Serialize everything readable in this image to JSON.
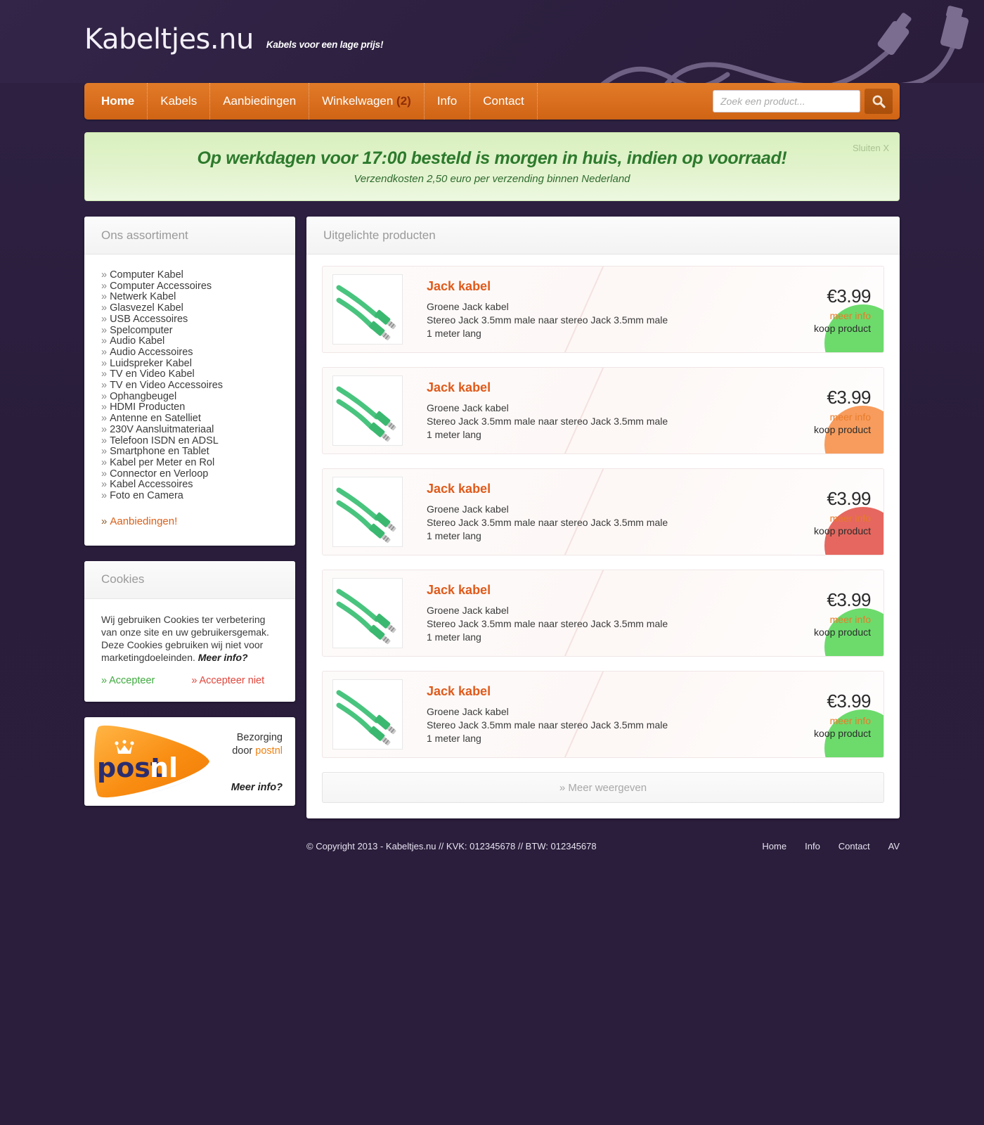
{
  "header": {
    "logo": "Kabeltjes.nu",
    "tagline": "Kabels voor een lage prijs!"
  },
  "nav": {
    "items": [
      {
        "label": "Home",
        "count": ""
      },
      {
        "label": "Kabels",
        "count": ""
      },
      {
        "label": "Aanbiedingen",
        "count": ""
      },
      {
        "label": "Winkelwagen",
        "count": "(2)"
      },
      {
        "label": "Info",
        "count": ""
      },
      {
        "label": "Contact",
        "count": ""
      }
    ],
    "cart_count": "(2)"
  },
  "search": {
    "placeholder": "Zoek een product...",
    "value": "",
    "icon": "search-icon"
  },
  "banner": {
    "title": "Op werkdagen voor 17:00 besteld is morgen in huis, indien op voorraad!",
    "subtitle": "Verzendkosten 2,50 euro per verzending binnen Nederland",
    "close_label": "Sluiten  X"
  },
  "sidebar": {
    "assortment": {
      "title": "Ons assortiment",
      "items": [
        "Computer Kabel",
        "Computer Accessoires",
        "Netwerk Kabel",
        "Glasvezel Kabel",
        "USB Accessoires",
        "Spelcomputer",
        "Audio Kabel",
        "Audio Accessoires",
        "Luidspreker Kabel",
        "TV en Video Kabel",
        "TV en Video Accessoires",
        "Ophangbeugel",
        "HDMI Producten",
        "Antenne en Satelliet",
        "230V Aansluitmateriaal",
        "Telefoon ISDN en ADSL",
        "Smartphone en Tablet",
        "Kabel per Meter en Rol",
        "Connector en Verloop",
        "Kabel Accessoires",
        "Foto en Camera"
      ],
      "special": "Aanbiedingen!"
    },
    "cookies": {
      "title": "Cookies",
      "body": "Wij gebruiken Cookies ter verbetering van onze site en uw gebruikersgemak. Deze Cookies gebruiken wij niet voor marketingdoeleinden.",
      "more_label": "Meer info?",
      "accept_label": "Accepteer",
      "decline_label": "Accepteer niet"
    },
    "postnl": {
      "logo_text": "postnl",
      "deliver_line1": "Bezorging",
      "deliver_line2_prefix": "door ",
      "deliver_brand": "postnl",
      "more_label": "Meer info?"
    }
  },
  "main": {
    "title": "Uitgelichte producten",
    "more_button": "» Meer weergeven",
    "products": [
      {
        "title": "Jack kabel",
        "desc1": "Groene Jack kabel",
        "desc2": "Stereo Jack 3.5mm male naar stereo Jack 3.5mm male",
        "desc3": "1 meter lang",
        "price": "€3.99",
        "more_info": "meer info",
        "buy": "koop product",
        "badge_color": "#6cdb6c",
        "image": "green-jack-cable-image"
      },
      {
        "title": "Jack kabel",
        "desc1": "Groene Jack kabel",
        "desc2": "Stereo Jack 3.5mm male naar stereo Jack 3.5mm male",
        "desc3": "1 meter lang",
        "price": "€3.99",
        "more_info": "meer info",
        "buy": "koop product",
        "badge_color": "#f79c5d",
        "image": "green-jack-cable-image"
      },
      {
        "title": "Jack kabel",
        "desc1": "Groene Jack kabel",
        "desc2": "Stereo Jack 3.5mm male naar stereo Jack 3.5mm male",
        "desc3": "1 meter lang",
        "price": "€3.99",
        "more_info": "meer info",
        "buy": "koop product",
        "badge_color": "#e5675f",
        "image": "green-jack-cable-image"
      },
      {
        "title": "Jack kabel",
        "desc1": "Groene Jack kabel",
        "desc2": "Stereo Jack 3.5mm male naar stereo Jack 3.5mm male",
        "desc3": "1 meter lang",
        "price": "€3.99",
        "more_info": "meer info",
        "buy": "koop product",
        "badge_color": "#6cdb6c",
        "image": "green-jack-cable-image"
      },
      {
        "title": "Jack kabel",
        "desc1": "Groene Jack kabel",
        "desc2": "Stereo Jack 3.5mm male naar stereo Jack 3.5mm male",
        "desc3": "1 meter lang",
        "price": "€3.99",
        "more_info": "meer info",
        "buy": "koop product",
        "badge_color": "#6cdb6c",
        "image": "green-jack-cable-image"
      }
    ]
  },
  "footer": {
    "copyright": "© Copyright 2013 - Kabeltjes.nu // KVK: 012345678 // BTW: 012345678",
    "links": [
      "Home",
      "Info",
      "Contact",
      "AV"
    ]
  },
  "colors": {
    "accent_orange": "#da6f1f",
    "product_title": "#e05a1a",
    "page_bg": "#2b1e3d",
    "banner_green": "#2d7a2d"
  }
}
